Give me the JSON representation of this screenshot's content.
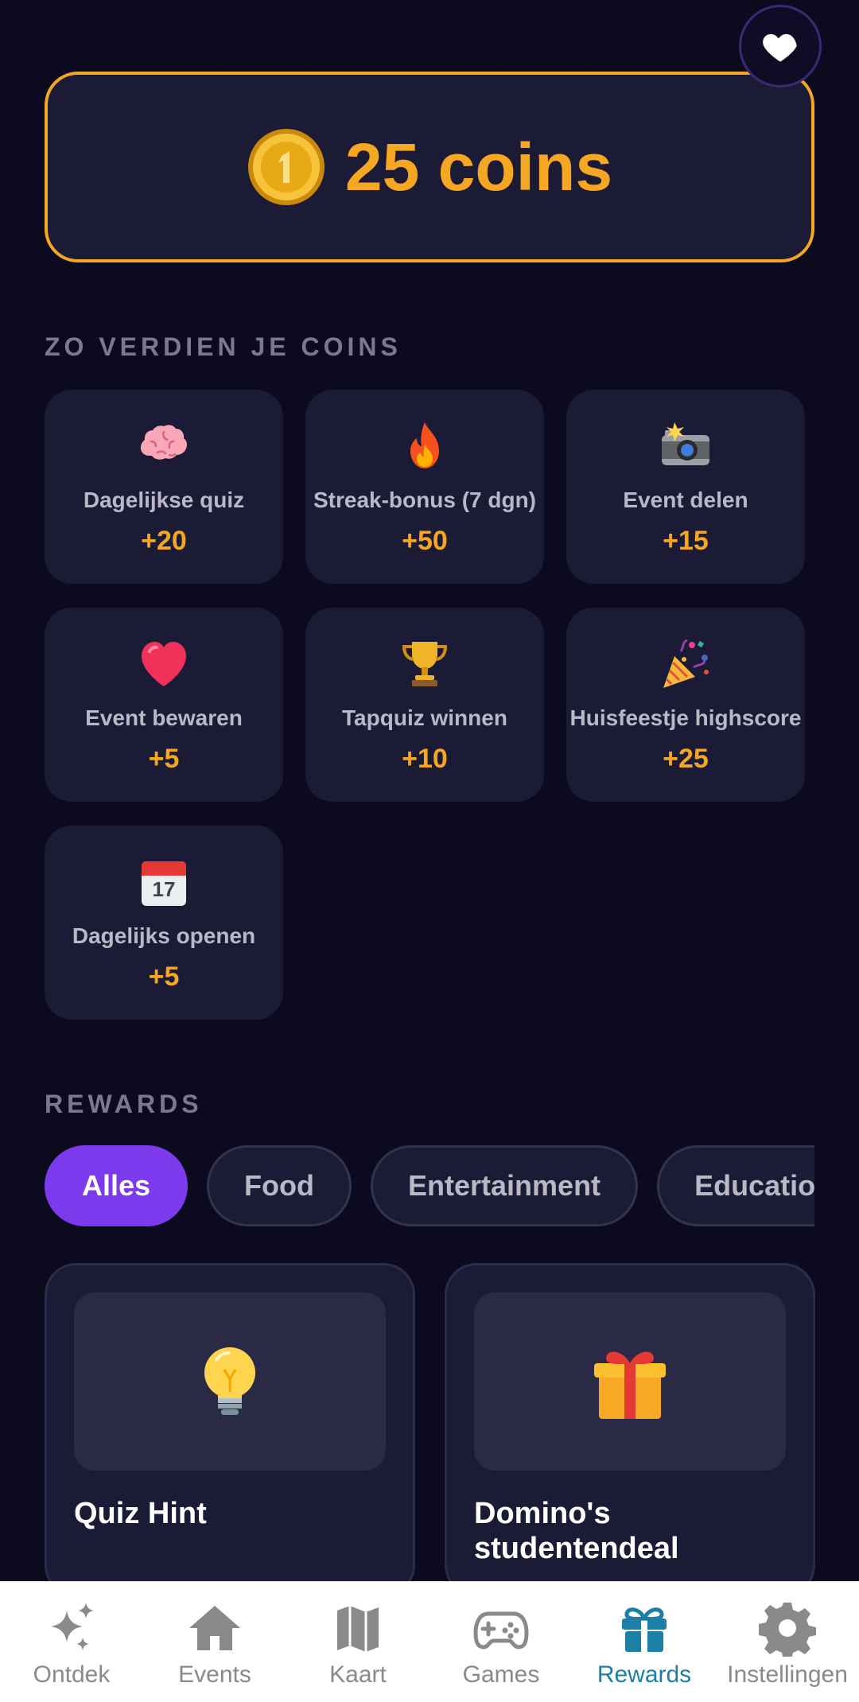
{
  "coins": {
    "amount_label": "25 coins"
  },
  "earn": {
    "title": "ZO VERDIEN JE COINS",
    "items": [
      {
        "icon": "brain-icon",
        "label": "Dagelijkse quiz",
        "points": "+20"
      },
      {
        "icon": "fire-icon",
        "label": "Streak-bonus (7 dgn)",
        "points": "+50"
      },
      {
        "icon": "camera-flash-icon",
        "label": "Event delen",
        "points": "+15"
      },
      {
        "icon": "heart-icon",
        "label": "Event bewaren",
        "points": "+5"
      },
      {
        "icon": "trophy-icon",
        "label": "Tapquiz winnen",
        "points": "+10"
      },
      {
        "icon": "party-popper-icon",
        "label": "Huisfeestje highscore",
        "points": "+25"
      },
      {
        "icon": "calendar-icon",
        "label": "Dagelijks openen",
        "points": "+5"
      }
    ]
  },
  "rewards": {
    "title": "REWARDS",
    "filters": [
      "Alles",
      "Food",
      "Entertainment",
      "Education"
    ],
    "active_filter": "Alles",
    "cards": [
      {
        "icon": "light-bulb-icon",
        "title": "Quiz Hint"
      },
      {
        "icon": "gift-icon",
        "title": "Domino's studentendeal"
      }
    ]
  },
  "nav": {
    "active": "Rewards",
    "items": [
      {
        "icon": "sparkles-icon",
        "label": "Ontdek"
      },
      {
        "icon": "home-icon",
        "label": "Events"
      },
      {
        "icon": "map-icon",
        "label": "Kaart"
      },
      {
        "icon": "gamepad-icon",
        "label": "Games"
      },
      {
        "icon": "gift-icon",
        "label": "Rewards"
      },
      {
        "icon": "gear-icon",
        "label": "Instellingen"
      }
    ]
  },
  "colors": {
    "background": "#0b0a1e",
    "card": "#1c1b36",
    "accent_gold": "#f5a623",
    "accent_purple": "#7c3aed",
    "nav_active": "#1c7fa6"
  }
}
